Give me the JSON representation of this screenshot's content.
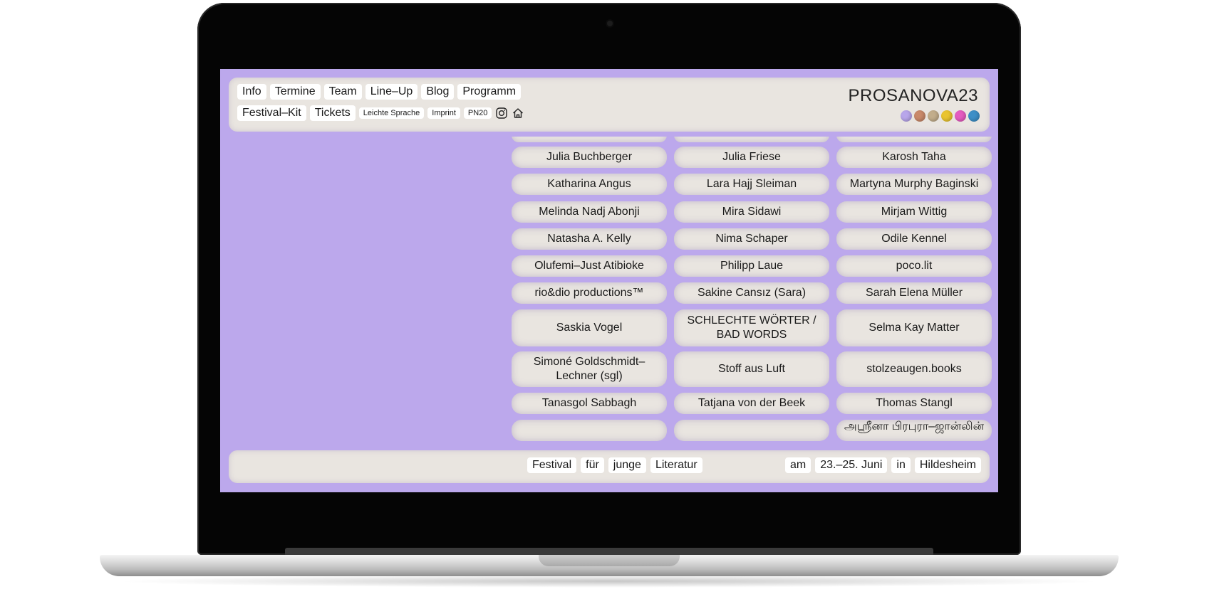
{
  "header": {
    "nav_row1": [
      "Info",
      "Termine",
      "Team",
      "Line–Up",
      "Blog",
      "Programm"
    ],
    "nav_row2": [
      "Festival–Kit",
      "Tickets"
    ],
    "nav_row2_small": [
      "Leichte Sprache",
      "Imprint",
      "PN20"
    ],
    "icons": [
      "instagram-icon",
      "home-icon"
    ],
    "logo": "PROSANOVA23",
    "dot_colors": [
      "#b8a6ea",
      "#c9896a",
      "#c2ad8b",
      "#e9c430",
      "#e45bc0",
      "#3d8fc7"
    ]
  },
  "artists": [
    [
      "Julia Buchberger",
      "Julia Friese",
      "Karosh Taha"
    ],
    [
      "Katharina Angus",
      "Lara Hajj Sleiman",
      "Martyna Murphy Baginski"
    ],
    [
      "Melinda Nadj Abonji",
      "Mira Sidawi",
      "Mirjam Wittig"
    ],
    [
      "Natasha A. Kelly",
      "Nima Schaper",
      "Odile Kennel"
    ],
    [
      "Olufemi–Just Atibioke",
      "Philipp Laue",
      "poco.lit"
    ],
    [
      "rio&dio productions™",
      "Sakine Cansız (Sara)",
      "Sarah Elena Müller"
    ],
    [
      "Saskia Vogel",
      "SCHLECHTE WÖRTER / BAD WORDS",
      "Selma Kay Matter"
    ],
    [
      "Simoné Goldschmidt–Lechner (sgl)",
      "Stoff aus Luft",
      "stolzeaugen.books"
    ],
    [
      "Tanasgol Sabbagh",
      "Tatjana von der Beek",
      "Thomas Stangl"
    ],
    [
      "",
      "",
      "அஸ்ரீனா பிரபுரா–ஜான்லின்"
    ]
  ],
  "footer": {
    "left": [
      "Festival",
      "für",
      "junge",
      "Literatur"
    ],
    "right": [
      "am",
      "23.–25. Juni",
      "in",
      "Hildesheim"
    ]
  },
  "colors": {
    "screen_bg": "#bca8ec",
    "pill_bg": "#e9e5e0"
  }
}
